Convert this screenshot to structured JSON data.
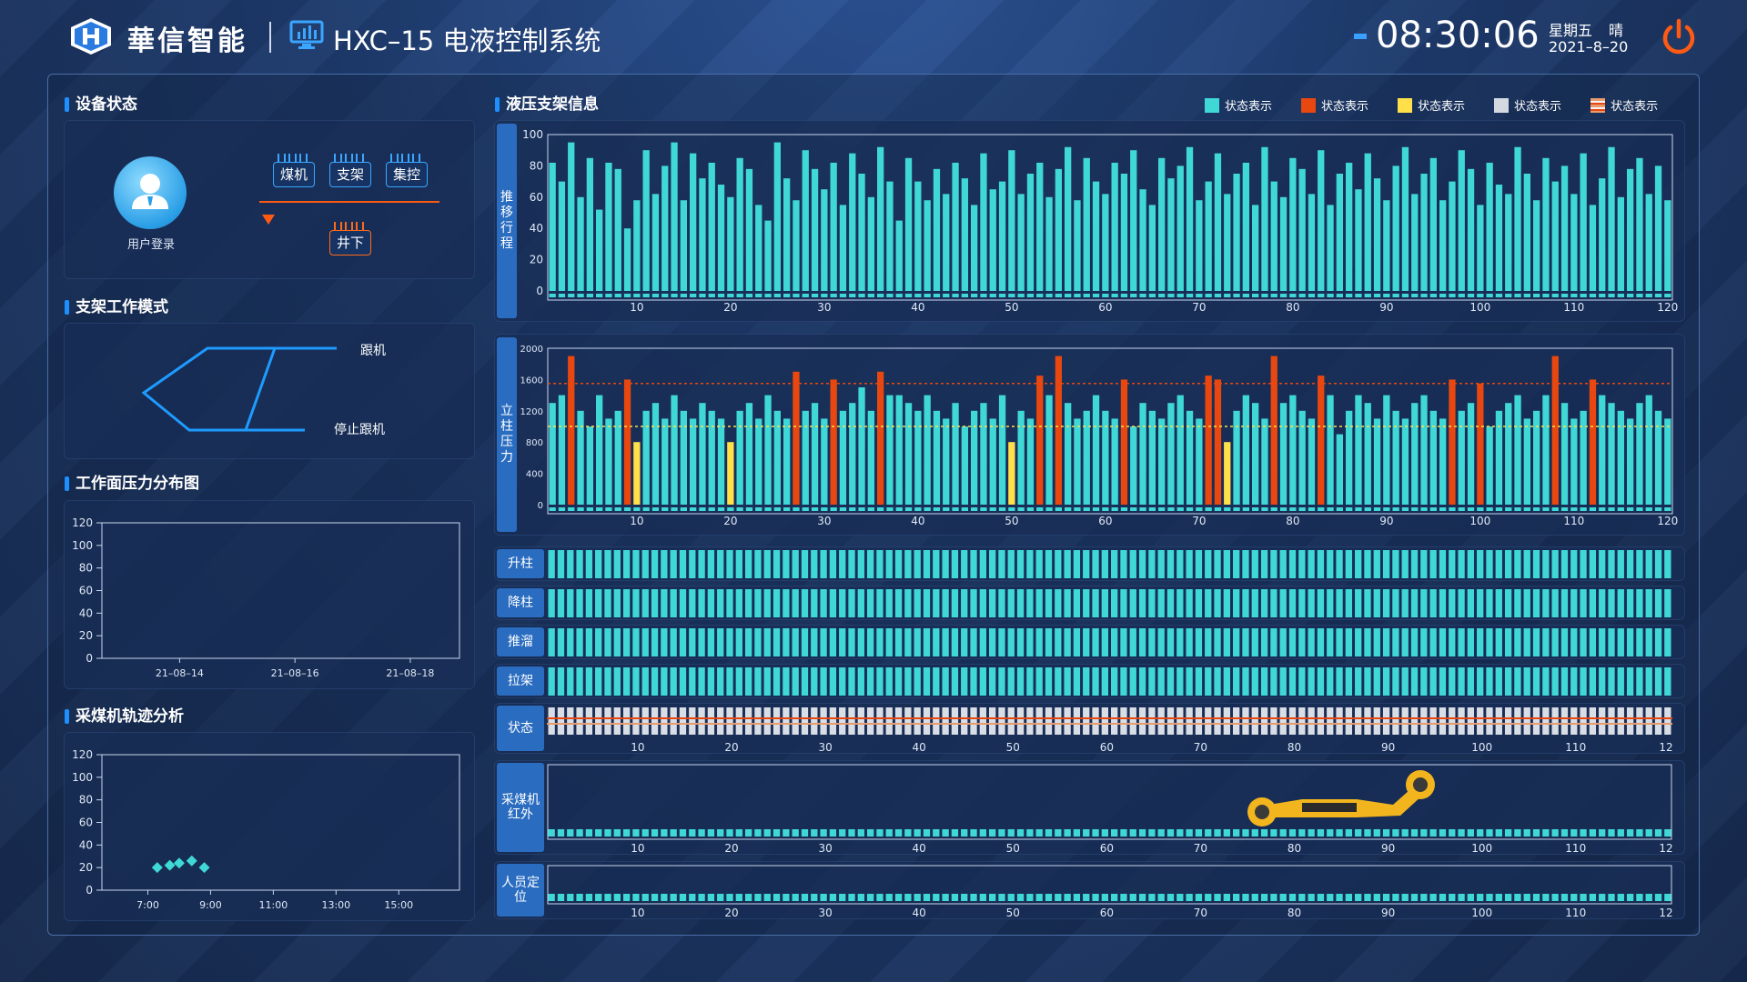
{
  "header": {
    "brand": "華信智能",
    "system_title": "HXC–15 电液控制系统",
    "time": "08:30:06",
    "weekday": "星期五",
    "weather": "晴",
    "date": "2021–8–20"
  },
  "left": {
    "device_status": {
      "title": "设备状态",
      "user_login": "用户登录",
      "buttons": [
        "煤机",
        "支架",
        "集控"
      ],
      "underground": "井下"
    },
    "work_mode": {
      "title": "支架工作模式",
      "follow": "跟机",
      "stop_follow": "停止跟机"
    },
    "pressure_chart": {
      "title": "工作面压力分布图"
    },
    "track_chart": {
      "title": "采煤机轨迹分析"
    }
  },
  "right": {
    "title": "液压支架信息",
    "legend": [
      {
        "label": "状态表示",
        "color": "#3fd8d6"
      },
      {
        "label": "状态表示",
        "color": "#e8470f"
      },
      {
        "label": "状态表示",
        "color": "#ffe04a"
      },
      {
        "label": "状态表示",
        "color": "#d4d8e0"
      },
      {
        "label": "状态表示",
        "color": "striped"
      }
    ],
    "stroke_label": "推移行程",
    "pressure_label": "立柱压力",
    "rows": {
      "raise": "升柱",
      "lower": "降柱",
      "push": "推溜",
      "pull": "拉架",
      "status": "状态",
      "shearer": "采煤机红外",
      "personnel": "人员定位"
    }
  },
  "chart_data": [
    {
      "type": "bar",
      "name": "推移行程",
      "ylabel": "推移行程",
      "ylim": [
        0,
        100
      ],
      "yticks": [
        0,
        20,
        40,
        60,
        80,
        100
      ],
      "xticks": [
        10,
        20,
        30,
        40,
        50,
        60,
        70,
        80,
        90,
        100,
        110,
        120
      ],
      "bar_count": 120,
      "values": [
        82,
        70,
        95,
        60,
        85,
        52,
        82,
        78,
        40,
        58,
        90,
        62,
        80,
        95,
        58,
        88,
        72,
        82,
        68,
        60,
        85,
        78,
        55,
        45,
        95,
        72,
        58,
        90,
        78,
        65,
        82,
        55,
        88,
        75,
        60,
        92,
        70,
        45,
        85,
        70,
        58,
        78,
        62,
        82,
        72,
        55,
        88,
        65,
        70,
        90,
        62,
        75,
        82,
        60,
        78,
        92,
        58,
        85,
        70,
        62,
        82,
        75,
        90,
        65,
        55,
        85,
        72,
        80,
        92,
        58,
        70,
        88,
        62,
        75,
        82,
        55,
        92,
        70,
        60,
        85,
        78,
        62,
        90,
        55,
        75,
        82,
        65,
        88,
        72,
        58,
        80,
        92,
        62,
        75,
        85,
        58,
        70,
        90,
        78,
        55,
        82,
        68,
        62,
        92,
        75,
        58,
        85,
        70,
        80,
        62,
        88,
        55,
        72,
        92,
        60,
        78,
        85,
        62,
        80,
        58
      ]
    },
    {
      "type": "bar",
      "name": "立柱压力",
      "ylabel": "立柱压力",
      "ylim": [
        0,
        2000
      ],
      "yticks": [
        0,
        400,
        800,
        1200,
        1600,
        2000
      ],
      "xticks": [
        10,
        20,
        30,
        40,
        50,
        60,
        70,
        80,
        90,
        100,
        110,
        120
      ],
      "bar_count": 120,
      "reference_lines": [
        1550,
        1000
      ],
      "values": [
        1300,
        1400,
        1900,
        1200,
        1000,
        1400,
        1100,
        1200,
        1600,
        800,
        1200,
        1300,
        1100,
        1400,
        1200,
        1100,
        1300,
        1200,
        1100,
        800,
        1200,
        1300,
        1100,
        1400,
        1200,
        1100,
        1700,
        1200,
        1300,
        1100,
        1600,
        1200,
        1300,
        1500,
        1200,
        1700,
        1400,
        1400,
        1300,
        1200,
        1400,
        1200,
        1100,
        1300,
        1000,
        1200,
        1300,
        1100,
        1400,
        800,
        1200,
        1100,
        1650,
        1400,
        1900,
        1300,
        1100,
        1200,
        1400,
        1200,
        1100,
        1600,
        1000,
        1300,
        1200,
        1100,
        1300,
        1400,
        1200,
        1100,
        1650,
        1600,
        800,
        1200,
        1400,
        1300,
        1100,
        1900,
        1300,
        1400,
        1200,
        1100,
        1650,
        1400,
        900,
        1200,
        1400,
        1300,
        1100,
        1400,
        1200,
        1100,
        1300,
        1400,
        1200,
        1100,
        1600,
        1200,
        1300,
        1550,
        1000,
        1200,
        1300,
        1400,
        1100,
        1200,
        1400,
        1900,
        1300,
        1100,
        1200,
        1600,
        1400,
        1300,
        1200,
        1100,
        1300,
        1400,
        1200,
        1100
      ],
      "series_colors": [
        "teal",
        "red",
        "yellow"
      ]
    },
    {
      "type": "line",
      "name": "工作面压力分布图",
      "ylim": [
        0,
        120
      ],
      "yticks": [
        0,
        20,
        40,
        60,
        80,
        100,
        120
      ],
      "x_tick_labels": [
        "21–08–14",
        "21–08–16",
        "21–08–18"
      ],
      "series": []
    },
    {
      "type": "scatter",
      "name": "采煤机轨迹分析",
      "ylim": [
        0,
        120
      ],
      "yticks": [
        0,
        20,
        40,
        60,
        80,
        100,
        120
      ],
      "x_tick_labels": [
        "7:00",
        "9:00",
        "11:00",
        "13:00",
        "15:00"
      ],
      "points": [
        [
          7.3,
          20
        ],
        [
          7.7,
          22
        ],
        [
          8.0,
          24
        ],
        [
          8.4,
          26
        ],
        [
          8.8,
          20
        ]
      ]
    }
  ]
}
